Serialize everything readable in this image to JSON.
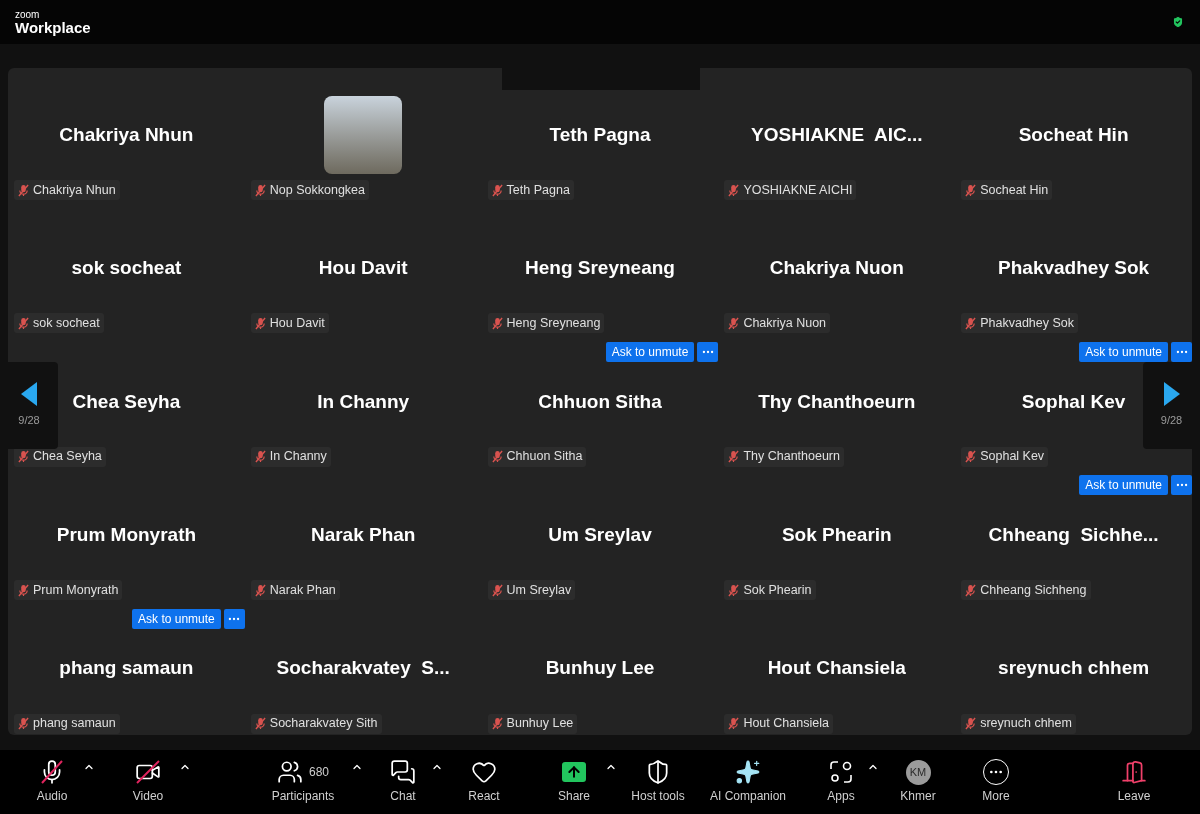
{
  "header": {
    "brand_top": "zoom",
    "brand_bottom": "Workplace"
  },
  "gallery": {
    "page_left": "9/28",
    "page_right": "9/28",
    "tiles": [
      {
        "kind": "name",
        "display": "Chakriya Nhun",
        "tag": "Chakriya Nhun",
        "muted": true
      },
      {
        "kind": "photo",
        "tag": "Nop Sokkongkea",
        "muted": true
      },
      {
        "kind": "name",
        "display": "Teth Pagna",
        "tag": "Teth Pagna",
        "muted": true
      },
      {
        "kind": "name",
        "display": "YOSHIAKNE  AIC...",
        "tag": "YOSHIAKNE AICHI",
        "muted": true
      },
      {
        "kind": "name",
        "display": "Socheat Hin",
        "tag": "Socheat Hin",
        "muted": true
      },
      {
        "kind": "name",
        "display": "sok socheat",
        "tag": "sok socheat",
        "muted": true
      },
      {
        "kind": "name",
        "display": "Hou Davit",
        "tag": "Hou Davit",
        "muted": true
      },
      {
        "kind": "name",
        "display": "Heng Sreyneang",
        "tag": "Heng Sreyneang",
        "muted": true
      },
      {
        "kind": "name",
        "display": "Chakriya Nuon",
        "tag": "Chakriya Nuon",
        "muted": true
      },
      {
        "kind": "name",
        "display": "Phakvadhey Sok",
        "tag": "Phakvadhey Sok",
        "muted": true
      },
      {
        "kind": "name",
        "display": "Chea Seyha",
        "tag": "Chea Seyha",
        "muted": true
      },
      {
        "kind": "name",
        "display": "In Channy",
        "tag": "In Channy",
        "muted": true
      },
      {
        "kind": "name",
        "display": "Chhuon Sitha",
        "tag": "Chhuon Sitha",
        "muted": true,
        "ask_button": "Ask to unmute"
      },
      {
        "kind": "name",
        "display": "Thy Chanthoeurn",
        "tag": "Thy Chanthoeurn",
        "muted": true
      },
      {
        "kind": "name",
        "display": "Sophal Kev",
        "tag": "Sophal Kev",
        "muted": true,
        "ask_button": "Ask to unmute"
      },
      {
        "kind": "name",
        "display": "Prum Monyrath",
        "tag": "Prum Monyrath",
        "muted": true
      },
      {
        "kind": "name",
        "display": "Narak Phan",
        "tag": "Narak Phan",
        "muted": true
      },
      {
        "kind": "name",
        "display": "Um Sreylav",
        "tag": "Um Sreylav",
        "muted": true
      },
      {
        "kind": "name",
        "display": "Sok Phearin",
        "tag": "Sok Phearin",
        "muted": true
      },
      {
        "kind": "name",
        "display": "Chheang  Sichhe...",
        "tag": "Chheang Sichheng",
        "muted": true,
        "ask_button": "Ask to unmute"
      },
      {
        "kind": "name",
        "display": "phang samaun",
        "tag": "phang samaun",
        "muted": true,
        "ask_button": "Ask to unmute"
      },
      {
        "kind": "name",
        "display": "Socharakvatey  S...",
        "tag": "Socharakvatey Sith",
        "muted": true
      },
      {
        "kind": "name",
        "display": "Bunhuy Lee",
        "tag": "Bunhuy Lee",
        "muted": true
      },
      {
        "kind": "name",
        "display": "Hout Chansiela",
        "tag": "Hout Chansiela",
        "muted": true
      },
      {
        "kind": "name",
        "display": "sreynuch chhem",
        "tag": "sreynuch chhem",
        "muted": true
      }
    ]
  },
  "toolbar": [
    {
      "kind": "audio",
      "label": "Audio",
      "off": true,
      "caret": true
    },
    {
      "kind": "video",
      "label": "Video",
      "off": true,
      "caret": true
    },
    {
      "kind": "participants",
      "label": "Participants",
      "count": "680",
      "caret": true
    },
    {
      "kind": "chat",
      "label": "Chat",
      "caret": true
    },
    {
      "kind": "react",
      "label": "React",
      "caret": false
    },
    {
      "kind": "share",
      "label": "Share",
      "caret": true
    },
    {
      "kind": "host",
      "label": "Host tools",
      "caret": false
    },
    {
      "kind": "ai",
      "label": "AI Companion",
      "caret": false
    },
    {
      "kind": "apps",
      "label": "Apps",
      "caret": true
    },
    {
      "kind": "avatar",
      "label": "Khmer",
      "initials": "KM",
      "caret": false
    },
    {
      "kind": "more",
      "label": "More",
      "caret": false
    },
    {
      "kind": "leave",
      "label": "Leave",
      "caret": false
    }
  ]
}
